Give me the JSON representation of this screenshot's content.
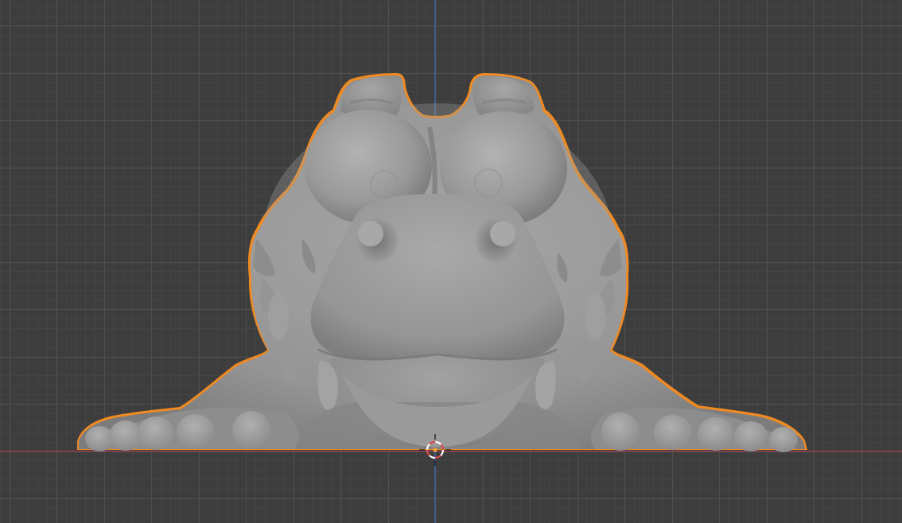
{
  "viewport": {
    "view": "front-orthographic",
    "shading": "solid",
    "background_color": "#3d3d3d",
    "grid_minor_color": "#444444",
    "grid_major_color": "#4f4f4f",
    "x_axis_color": "#a03a48",
    "z_axis_color": "#3d66a8",
    "grid": true
  },
  "scene": {
    "object": {
      "name": "crocodile-sculpt",
      "selected": true,
      "outline_color": "#ef8a22",
      "material_color": "#9a9a9a"
    },
    "cursor_3d": {
      "icon": "3d-cursor-icon",
      "ring_colors": [
        "#d94a4a",
        "#ffffff"
      ]
    }
  }
}
